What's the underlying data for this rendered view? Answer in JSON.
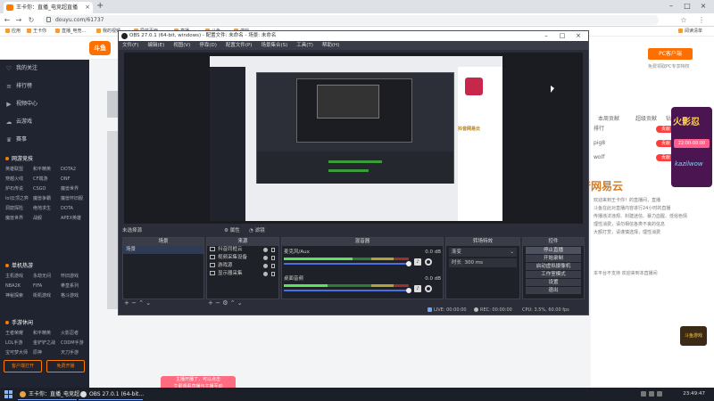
{
  "browser": {
    "tab_title": "王卡你：直播_电竞超直播",
    "url": "douyu.com/61737",
    "bookmarks": [
      "应用",
      "王卡你",
      "直播_电竞...",
      "我的视频",
      "导航页面",
      "直播...",
      "斗鱼...",
      "游戏"
    ],
    "reading_list": "阅读清单"
  },
  "site": {
    "logo_text": "斗鱼",
    "pc_button": "PC客户端",
    "pc_sub": "免费领取PC专享特权",
    "rank_tabs": [
      "本周贡献",
      "超级贡献",
      "钻石"
    ],
    "rank_rows": [
      {
        "name": "排行",
        "badge": "贡献"
      },
      {
        "name": "pig8",
        "badge": "贡献"
      },
      {
        "name": "wolf",
        "badge": "贡献"
      }
    ],
    "chat_lines": [
      "欢迎来到王卡你！的直播间，直播",
      "斗鱼在此对直播内容进行24小时的直播",
      "传播违法违规、封建迷信、暴力血腥、低俗色情",
      "理性消费，请勿相信各类不良的信息",
      "大额打赏，请谨慎选择，理性消费",
      "本平台不支持 欢迎来到本直播间"
    ],
    "promo_title": "火影忍",
    "promo_time": "22:00-00:00",
    "promo_brand": "kazilwow",
    "game_logo": "斗鱼游戏",
    "overlay_text": "抖音网易云",
    "toast_line1": "主播开播了，可以点击",
    "toast_line2": "立即观看直播与主播互动"
  },
  "sidebar": {
    "items": [
      {
        "icon": "heart-icon",
        "label": "我的关注"
      },
      {
        "icon": "list-icon",
        "label": "排行榜"
      },
      {
        "icon": "video-icon",
        "label": "视频中心"
      },
      {
        "icon": "cloud-icon",
        "label": "云游戏"
      },
      {
        "icon": "trophy-icon",
        "label": "赛事"
      }
    ],
    "categories": [
      {
        "title": "网游竞技",
        "items": [
          "英雄联盟",
          "和平精英",
          "DOTA2",
          "穿越火线",
          "CF端游",
          "DNF",
          "炉石传说",
          "CSGO",
          "魔兽世界",
          "lol云顶之弈",
          "魔兽争霸",
          "魔兽怀旧服",
          "洞窟探险",
          "绝地求生",
          "DOTA",
          "魔兽世界",
          "战舰",
          "APEX英雄"
        ]
      },
      {
        "title": "单机热游",
        "items": [
          "主机游戏",
          "永劫无间",
          "怀旧游戏",
          "NBA2K",
          "FIFA",
          "拳皇系列",
          "神秘探索",
          "街机游戏",
          "格斗游戏"
        ]
      },
      {
        "title": "手游休闲",
        "items": [
          "王者荣耀",
          "和平精英",
          "火影忍者",
          "LOL手游",
          "金铲铲之战",
          "CODM手游",
          "宝可梦大师",
          "原神",
          "天刀手游"
        ]
      }
    ],
    "btn_client": "客户端打开",
    "btn_open": "免费开播"
  },
  "obs": {
    "title": "OBS 27.0.1 (64-bit, windows) - 配置文件: 未命名 - 场景: 未命名",
    "menu": [
      "文件(F)",
      "编辑(E)",
      "视图(V)",
      "停靠(D)",
      "配置文件(P)",
      "场景集合(S)",
      "工具(T)",
      "帮助(H)"
    ],
    "scene_select_label": "未选择源",
    "toolbar_props": "属性",
    "toolbar_filter": "滤镜",
    "docks": {
      "scenes": {
        "title": "场景",
        "items": [
          "场景"
        ]
      },
      "sources": {
        "title": "来源",
        "items": [
          "抖音同框云",
          "视频采集设备",
          "游戏源",
          "显示器采集"
        ]
      },
      "mixer": {
        "title": "混音器",
        "channels": [
          {
            "name": "麦克风/Aux",
            "db": "0.0 dB",
            "level": 0.55
          },
          {
            "name": "桌面音频",
            "db": "0.0 dB",
            "level": 0.35
          }
        ]
      },
      "transitions": {
        "title": "转场特效",
        "type": "渐变",
        "duration_label": "时长",
        "duration": "300 ms"
      },
      "controls": {
        "title": "控件",
        "buttons": [
          "停止直播",
          "开始录制",
          "启动虚拟摄像机",
          "工作室模式",
          "设置",
          "退出"
        ]
      }
    },
    "status": {
      "live": "LIVE: 00:00:00",
      "rec": "REC: 00:00:00",
      "cpu": "CPU: 3.5%, 60.00 fps"
    }
  },
  "taskbar": {
    "items": [
      "王卡你：直播_电竞超...",
      "OBS 27.0.1 (64-bit..."
    ],
    "time": "23:49:47",
    "date": "2021/9/17"
  }
}
